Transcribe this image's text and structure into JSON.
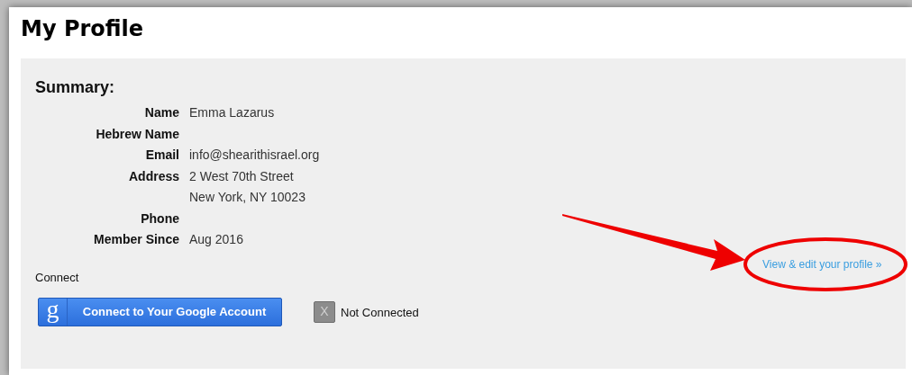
{
  "page": {
    "title": "My Profile"
  },
  "summary": {
    "heading": "Summary:",
    "fields": [
      {
        "label": "Name",
        "values": [
          "Emma Lazarus"
        ]
      },
      {
        "label": "Hebrew Name"
      },
      {
        "label": "Email",
        "values": [
          "info@shearithisrael.org"
        ]
      },
      {
        "label": "Address",
        "values": [
          "2 West 70th Street",
          "New York, NY 10023"
        ]
      },
      {
        "label": "Phone"
      },
      {
        "label": "Member Since",
        "values": [
          "Aug 2016"
        ]
      }
    ]
  },
  "edit_link": "View & edit your profile »",
  "connect": {
    "heading": "Connect",
    "google_button": {
      "icon_letter": "g",
      "label": "Connect to Your Google Account"
    },
    "status": {
      "connected": false,
      "icon": "X",
      "label": "Not Connected"
    }
  }
}
